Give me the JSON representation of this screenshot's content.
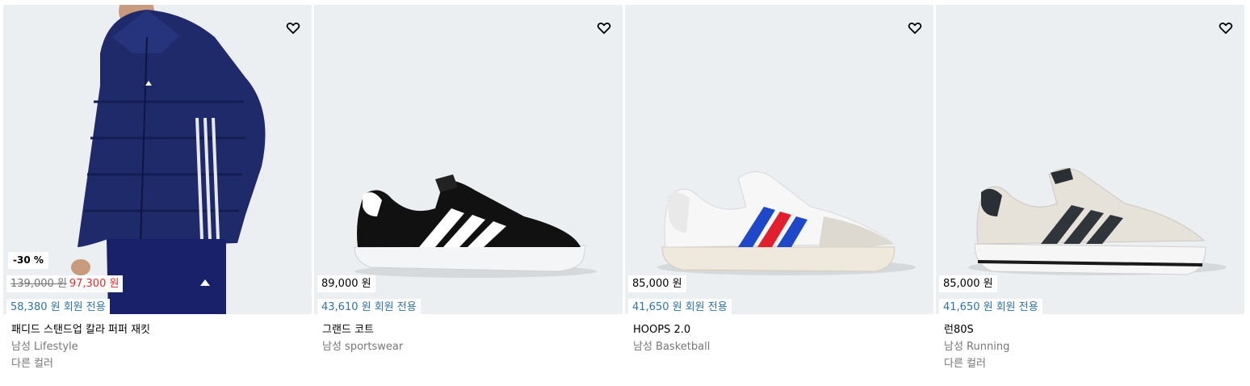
{
  "products": [
    {
      "name": "패디드 스탠드업 칼라 퍼퍼 재킷",
      "category": "남성 Lifestyle",
      "colors_text": "다른 컬러",
      "discount_badge": "-30 %",
      "original_price": "139,000 원",
      "sale_price": "97,300 원",
      "member_price": "58,380 원 회원 전용",
      "wishlist_icon": "heart-icon"
    },
    {
      "name": "그랜드 코트",
      "category": "남성 sportswear",
      "price": "89,000 원",
      "member_price": "43,610 원 회원 전용",
      "wishlist_icon": "heart-icon"
    },
    {
      "name": "HOOPS 2.0",
      "category": "남성 Basketball",
      "price": "85,000 원",
      "member_price": "41,650 원 회원 전용",
      "wishlist_icon": "heart-icon"
    },
    {
      "name": "런80S",
      "category": "남성 Running",
      "colors_text": "다른 컬러",
      "price": "85,000 원",
      "member_price": "41,650 원 회원 전용",
      "wishlist_icon": "heart-icon"
    }
  ],
  "colors": {
    "image_bg": "#eceff1",
    "sale_red": "#e32b2b",
    "member_blue": "#2f73a8",
    "muted_gray": "#767677"
  }
}
